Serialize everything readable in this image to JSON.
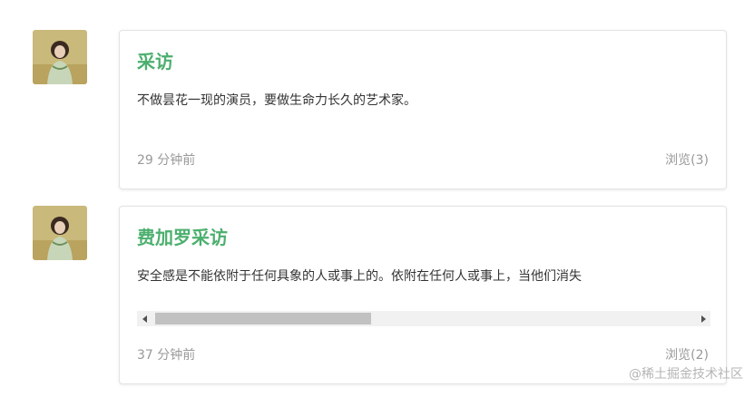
{
  "posts": [
    {
      "title": "采访",
      "content": "不做昙花一现的演员，要做生命力长久的艺术家。",
      "time": "29 分钟前",
      "views": "浏览(3)"
    },
    {
      "title": "费加罗采访",
      "content": "安全感是不能依附于任何具象的人或事上的。依附在任何人或事上，当他们消失",
      "time": "37 分钟前",
      "views": "浏览(2)",
      "scroll_position": 0.0
    }
  ],
  "watermark": "@稀土掘金技术社区",
  "colors": {
    "accent": "#4caf6e",
    "muted": "#999999",
    "text": "#333333"
  }
}
